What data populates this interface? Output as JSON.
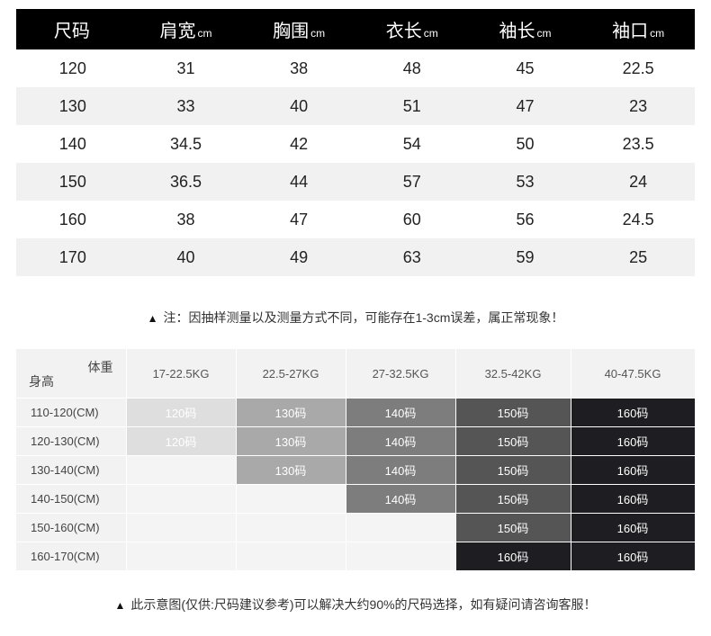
{
  "size_table": {
    "headers": [
      {
        "label": "尺码",
        "unit": ""
      },
      {
        "label": "肩宽",
        "unit": "cm"
      },
      {
        "label": "胸围",
        "unit": "cm"
      },
      {
        "label": "衣长",
        "unit": "cm"
      },
      {
        "label": "袖长",
        "unit": "cm"
      },
      {
        "label": "袖口",
        "unit": "cm"
      }
    ],
    "rows": [
      [
        "120",
        "31",
        "38",
        "48",
        "45",
        "22.5"
      ],
      [
        "130",
        "33",
        "40",
        "51",
        "47",
        "23"
      ],
      [
        "140",
        "34.5",
        "42",
        "54",
        "50",
        "23.5"
      ],
      [
        "150",
        "36.5",
        "44",
        "57",
        "53",
        "24"
      ],
      [
        "160",
        "38",
        "47",
        "60",
        "56",
        "24.5"
      ],
      [
        "170",
        "40",
        "49",
        "63",
        "59",
        "25"
      ]
    ]
  },
  "note1": {
    "icon": "warning-triangle-icon",
    "text": "注：因抽样测量以及测量方式不同，可能存在1-3cm误差，属正常现象！"
  },
  "recommend": {
    "corner_weight": "体重",
    "corner_height": "身高",
    "weight_headers": [
      "17-22.5KG",
      "22.5-27KG",
      "27-32.5KG",
      "32.5-42KG",
      "40-47.5KG"
    ],
    "rows": [
      {
        "height": "110-120(CM)",
        "cells": [
          "120码",
          "130码",
          "140码",
          "150码",
          "160码"
        ]
      },
      {
        "height": "120-130(CM)",
        "cells": [
          "120码",
          "130码",
          "140码",
          "150码",
          "160码"
        ]
      },
      {
        "height": "130-140(CM)",
        "cells": [
          "",
          "130码",
          "140码",
          "150码",
          "160码"
        ]
      },
      {
        "height": "140-150(CM)",
        "cells": [
          "",
          "",
          "140码",
          "150码",
          "160码"
        ]
      },
      {
        "height": "150-160(CM)",
        "cells": [
          "",
          "",
          "",
          "150码",
          "160码"
        ]
      },
      {
        "height": "160-170(CM)",
        "cells": [
          "",
          "",
          "",
          "160码",
          "160码"
        ]
      }
    ],
    "colors": {
      "120码": "#dedede",
      "130码": "#a9a9a9",
      "140码": "#7d7d7d",
      "150码": "#555555",
      "160码": "#1e1e22"
    }
  },
  "note2": {
    "icon": "warning-triangle-icon",
    "text": "此示意图(仅供:尺码建议参考)可以解决大约90%的尺码选择，如有疑问请咨询客服！"
  }
}
